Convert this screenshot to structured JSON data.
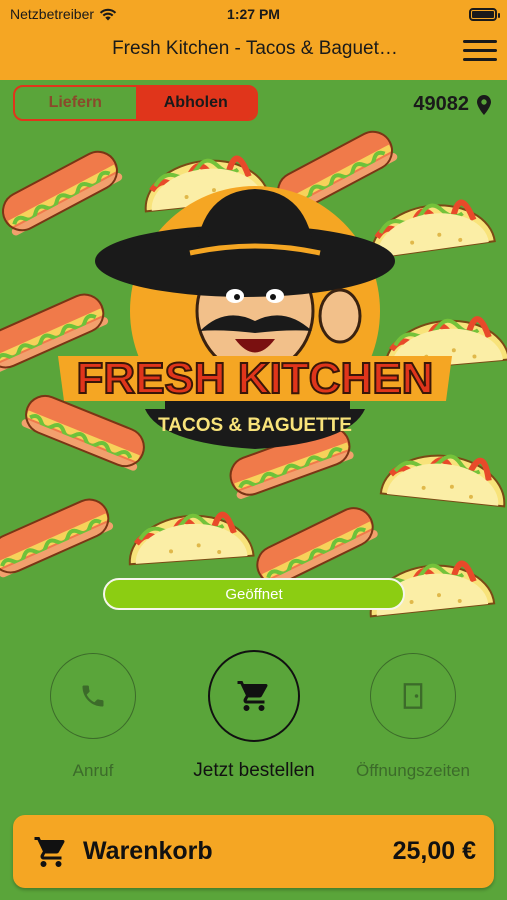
{
  "status_bar": {
    "carrier": "Netzbetreiber",
    "time": "1:27 PM"
  },
  "header": {
    "title": "Fresh Kitchen - Tacos & Baguet…"
  },
  "delivery_toggle": {
    "options": [
      "Liefern",
      "Abholen"
    ],
    "selected": "Abholen"
  },
  "location": {
    "zip": "49082"
  },
  "hero": {
    "logo_line1": "FRESH KITCHEN",
    "logo_line2": "TACOS & BAGUETTE",
    "open_status": "Geöffnet"
  },
  "actions": {
    "call": "Anruf",
    "order": "Jetzt bestellen",
    "hours": "Öffnungszeiten"
  },
  "cart": {
    "label": "Warenkorb",
    "total": "25,00 €"
  },
  "colors": {
    "header": "#f5a623",
    "background": "#5aa53a",
    "toggle_active": "#e0351b",
    "open_pill": "#8ccd12"
  }
}
